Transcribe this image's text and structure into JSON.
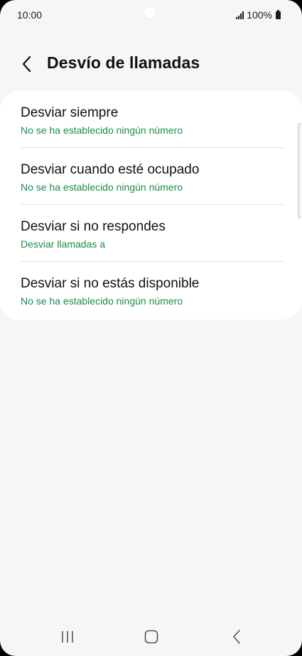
{
  "status_bar": {
    "time": "10:00",
    "battery": "100%"
  },
  "header": {
    "title": "Desvío de llamadas"
  },
  "items": [
    {
      "title": "Desviar siempre",
      "subtitle": "No se ha establecido ningún número"
    },
    {
      "title": "Desviar cuando esté ocupado",
      "subtitle": "No se ha establecido ningún número"
    },
    {
      "title": "Desviar si no respondes",
      "subtitle": "Desviar llamadas a"
    },
    {
      "title": "Desviar si no estás disponible",
      "subtitle": "No se ha establecido ningún número"
    }
  ],
  "colors": {
    "subtitle": "#1e8a4c",
    "background": "#f6f6f6",
    "card": "#ffffff"
  },
  "icons": {
    "back": "chevron-left-icon",
    "signal": "signal-icon",
    "battery": "battery-icon",
    "recents": "recent-apps-icon",
    "home": "home-icon",
    "nav_back": "nav-back-icon"
  }
}
